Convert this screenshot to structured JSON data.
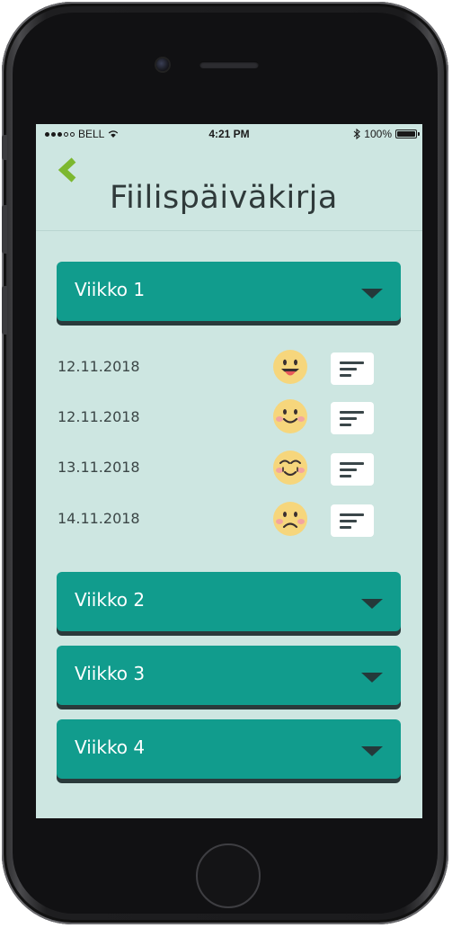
{
  "status_bar": {
    "carrier": "BELL",
    "time": "4:21 PM",
    "battery": "100%",
    "battery_level": 1.0,
    "signal_bars_filled": 3,
    "signal_bars_total": 5
  },
  "header": {
    "title": "Fiilispäiväkirja",
    "back_icon": "chevron-left-icon",
    "accent_color": "#7cb82f"
  },
  "weeks": [
    {
      "label": "Viikko 1",
      "expanded": true,
      "entries": [
        {
          "date": "12.11.2018",
          "mood": "tongue-out-icon",
          "note_icon": "notes-icon"
        },
        {
          "date": "12.11.2018",
          "mood": "smile-icon",
          "note_icon": "notes-icon"
        },
        {
          "date": "13.11.2018",
          "mood": "happy-squint-icon",
          "note_icon": "notes-icon"
        },
        {
          "date": "14.11.2018",
          "mood": "sad-icon",
          "note_icon": "notes-icon"
        }
      ]
    },
    {
      "label": "Viikko 2",
      "expanded": false
    },
    {
      "label": "Viikko 3",
      "expanded": false
    },
    {
      "label": "Viikko 4",
      "expanded": false
    }
  ],
  "colors": {
    "background": "#cde6e1",
    "week_header": "#119c8d",
    "week_header_shadow": "#2a3a3b",
    "emoji_face": "#f6d67c",
    "text": "#3b4646"
  }
}
